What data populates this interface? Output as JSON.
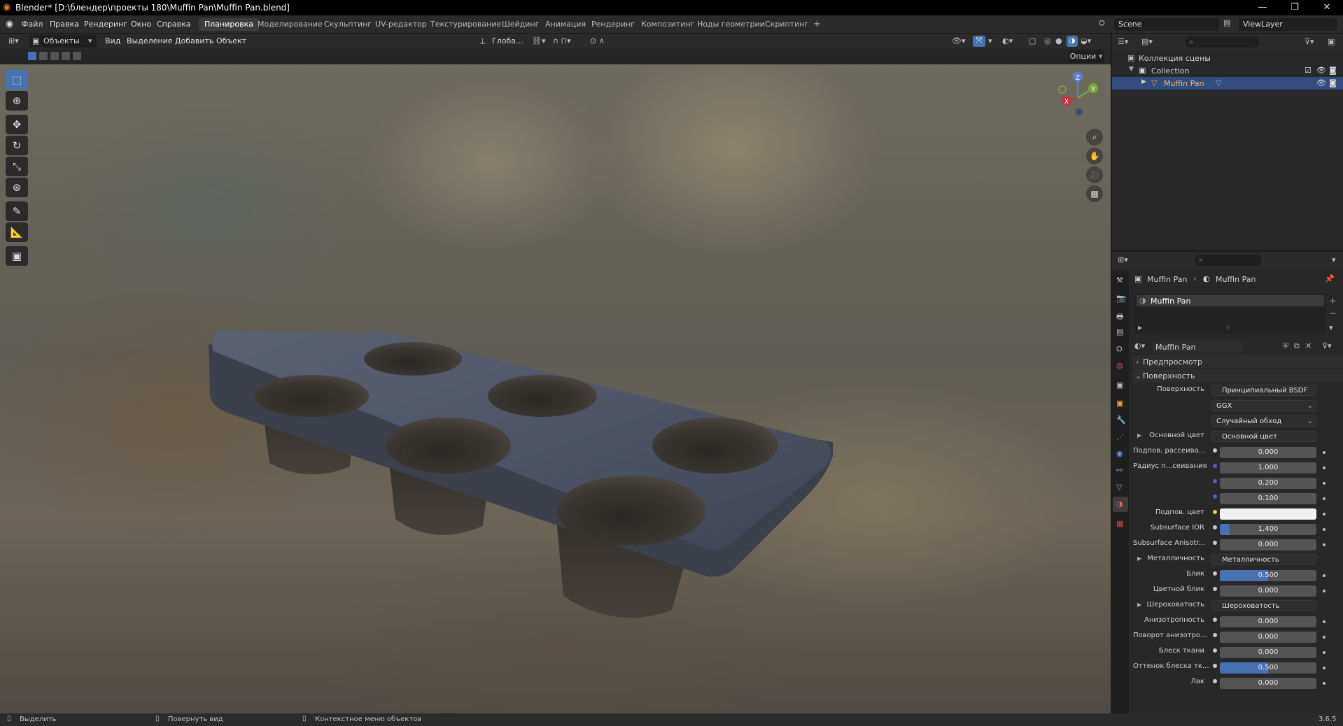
{
  "title_bar": {
    "title": "Blender* [D:\\блендер\\проекты 180\\Muffin Pan\\Muffin Pan.blend]",
    "minimize": "—",
    "maximize": "❐",
    "close": "✕"
  },
  "menu": [
    "Файл",
    "Правка",
    "Рендеринг",
    "Окно",
    "Справка"
  ],
  "workspaces": [
    "Планировка",
    "Моделирование",
    "Скульптинг",
    "UV-редактор",
    "Текстурирование",
    "Шейдинг",
    "Анимация",
    "Рендеринг",
    "Композитинг",
    "Ноды геометрии",
    "Скриптинг"
  ],
  "workspace_add": "+",
  "scene": {
    "name": "Scene",
    "view_layer": "ViewLayer"
  },
  "viewport_header": {
    "mode": "Объекты",
    "menus": [
      "Вид",
      "Выделение",
      "Добавить",
      "Объект"
    ],
    "orientation": "Глоба...",
    "options": "Опции"
  },
  "gizmo": {
    "z": "Z",
    "y": "Y",
    "x": "X"
  },
  "outliner": {
    "root": "Коллекция сцены",
    "collection": "Collection",
    "object": "Muffin Pan"
  },
  "properties": {
    "breadcrumb": [
      "Muffin Pan",
      "Muffin Pan"
    ],
    "slot": "Muffin Pan",
    "material_name": "Muffin Pan",
    "panels": {
      "preview": "Предпросмотр",
      "surface": "Поверхность"
    },
    "rows": [
      {
        "label": "Поверхность",
        "value": "Принципиальный BSDF",
        "kind": "link"
      },
      {
        "label": "",
        "value": "GGX",
        "kind": "select"
      },
      {
        "label": "",
        "value": "Случайный обход",
        "kind": "select"
      },
      {
        "label": "Основной цвет",
        "value": "Основной цвет",
        "kind": "link",
        "expand": true
      },
      {
        "label": "Подпов. рассеива...",
        "value": "0.000",
        "kind": "num"
      },
      {
        "label": "Радиус п...сеивания",
        "value": "1.000",
        "kind": "num"
      },
      {
        "label": "",
        "value": "0.200",
        "kind": "num"
      },
      {
        "label": "",
        "value": "0.100",
        "kind": "num"
      },
      {
        "label": "Подпов. цвет",
        "value": "",
        "kind": "color"
      },
      {
        "label": "Subsurface IOR",
        "value": "1.400",
        "kind": "num",
        "fill": 0.1
      },
      {
        "label": "Subsurface Anisotr...",
        "value": "0.000",
        "kind": "num"
      },
      {
        "label": "Металличность",
        "value": "Металличность",
        "kind": "link",
        "expand": true
      },
      {
        "label": "Блик",
        "value": "0.500",
        "kind": "num",
        "fill": 0.5
      },
      {
        "label": "Цветной блик",
        "value": "0.000",
        "kind": "num"
      },
      {
        "label": "Шероховатость",
        "value": "Шероховатость",
        "kind": "link",
        "expand": true
      },
      {
        "label": "Анизотропность",
        "value": "0.000",
        "kind": "num"
      },
      {
        "label": "Поворот анизотро...",
        "value": "0.000",
        "kind": "num"
      },
      {
        "label": "Блеск ткани",
        "value": "0.000",
        "kind": "num"
      },
      {
        "label": "Оттенок блеска тк...",
        "value": "0.500",
        "kind": "num",
        "fill": 0.5
      },
      {
        "label": "Лак",
        "value": "0.000",
        "kind": "num"
      }
    ]
  },
  "status_bar": {
    "select": "Выделить",
    "rotate": "Повернуть вид",
    "context": "Контекстное меню объектов",
    "version": "3.6.5"
  },
  "colors": {
    "accent": "#4772b3",
    "panel": "#282828",
    "header": "#2b2b2b"
  }
}
